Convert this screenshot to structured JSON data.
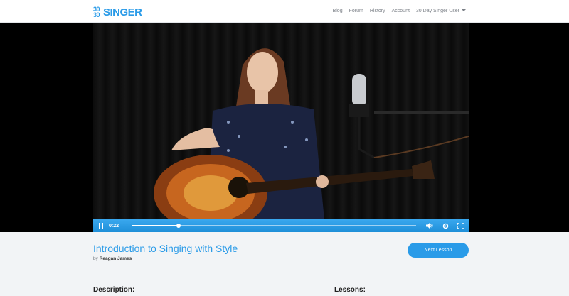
{
  "brand": {
    "mark": "30 30",
    "word": "SINGER",
    "accent": "#2a9be8"
  },
  "nav": {
    "blog": "Blog",
    "forum": "Forum",
    "history": "History",
    "account": "Account",
    "user": "30 Day Singer User"
  },
  "player": {
    "current_time": "0:22",
    "progress_fraction": 0.165,
    "pause_icon": "pause-icon",
    "volume_icon": "volume-icon",
    "settings_icon": "gear-icon",
    "fullscreen_icon": "fullscreen-icon",
    "bar_color": "#2a9be8"
  },
  "lesson": {
    "title": "Introduction to Singing with Style",
    "by_prefix": "by",
    "author": "Reagan James",
    "next_label": "Next Lesson"
  },
  "sections": {
    "description": "Description:",
    "lessons": "Lessons:"
  }
}
